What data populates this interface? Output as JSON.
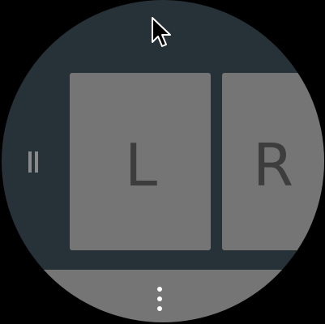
{
  "keys": {
    "left_label": "L",
    "right_label": "R"
  },
  "icons": {
    "pause": "pause-icon",
    "more": "more-vertical-icon",
    "cursor": "mouse-pointer-icon"
  },
  "colors": {
    "background": "#263238",
    "tile": "#757575",
    "tile_text": "#3d3d3d",
    "dots": "#ffffff"
  }
}
